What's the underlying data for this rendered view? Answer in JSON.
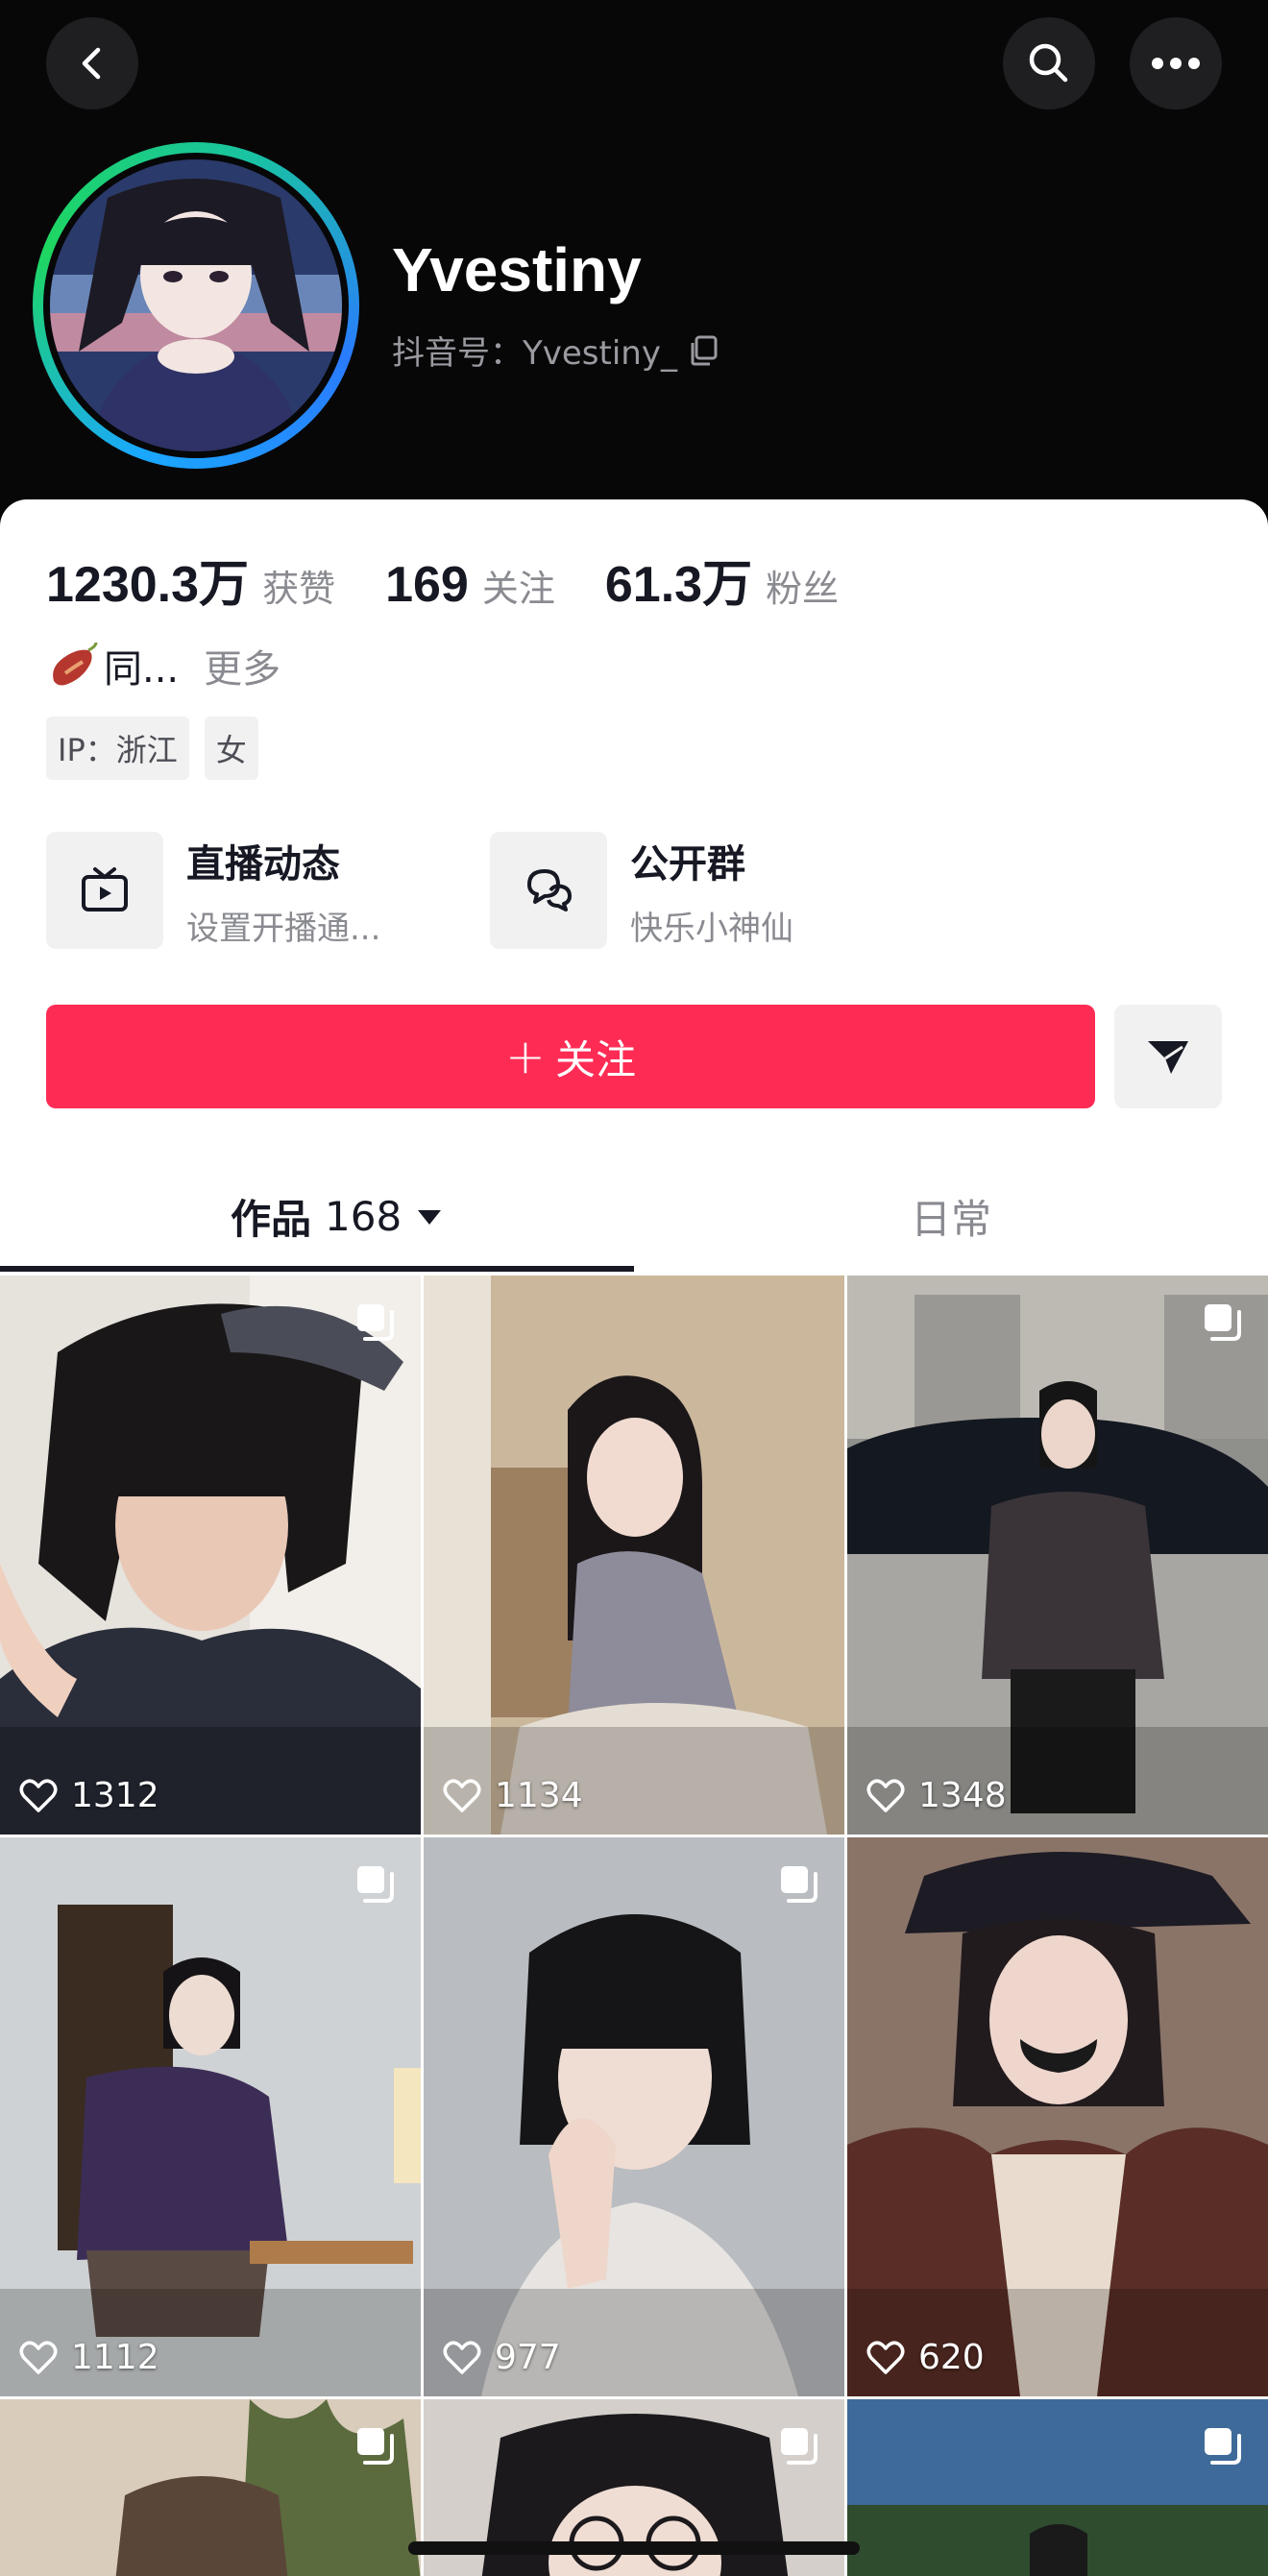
{
  "profile": {
    "nickname": "Yvestiny",
    "douyin_id": "抖音号：Yvestiny_"
  },
  "stats": [
    {
      "value": "1230.3万",
      "label": "获赞"
    },
    {
      "value": "169",
      "label": "关注"
    },
    {
      "value": "61.3万",
      "label": "粉丝"
    }
  ],
  "bio": {
    "text": "同...",
    "more": "更多"
  },
  "tags": [
    "IP：浙江",
    "女"
  ],
  "features": {
    "live": {
      "title": "直播动态",
      "subtitle": "设置开播通..."
    },
    "group": {
      "title": "公开群",
      "subtitle": "快乐小神仙"
    }
  },
  "actions": {
    "follow_label": "关注",
    "follow_plus": "+"
  },
  "tabs": {
    "works_label": "作品",
    "works_count": "168",
    "daily_label": "日常"
  },
  "videos": [
    {
      "likes": "1312"
    },
    {
      "likes": "1134"
    },
    {
      "likes": "1348"
    },
    {
      "likes": "1112"
    },
    {
      "likes": "977"
    },
    {
      "likes": "620"
    },
    {
      "likes": ""
    },
    {
      "likes": ""
    },
    {
      "likes": ""
    }
  ],
  "colors": {
    "accent": "#fe2c55",
    "header_bg": "#070708",
    "text_primary": "#161823",
    "text_secondary": "#8a8b91"
  }
}
